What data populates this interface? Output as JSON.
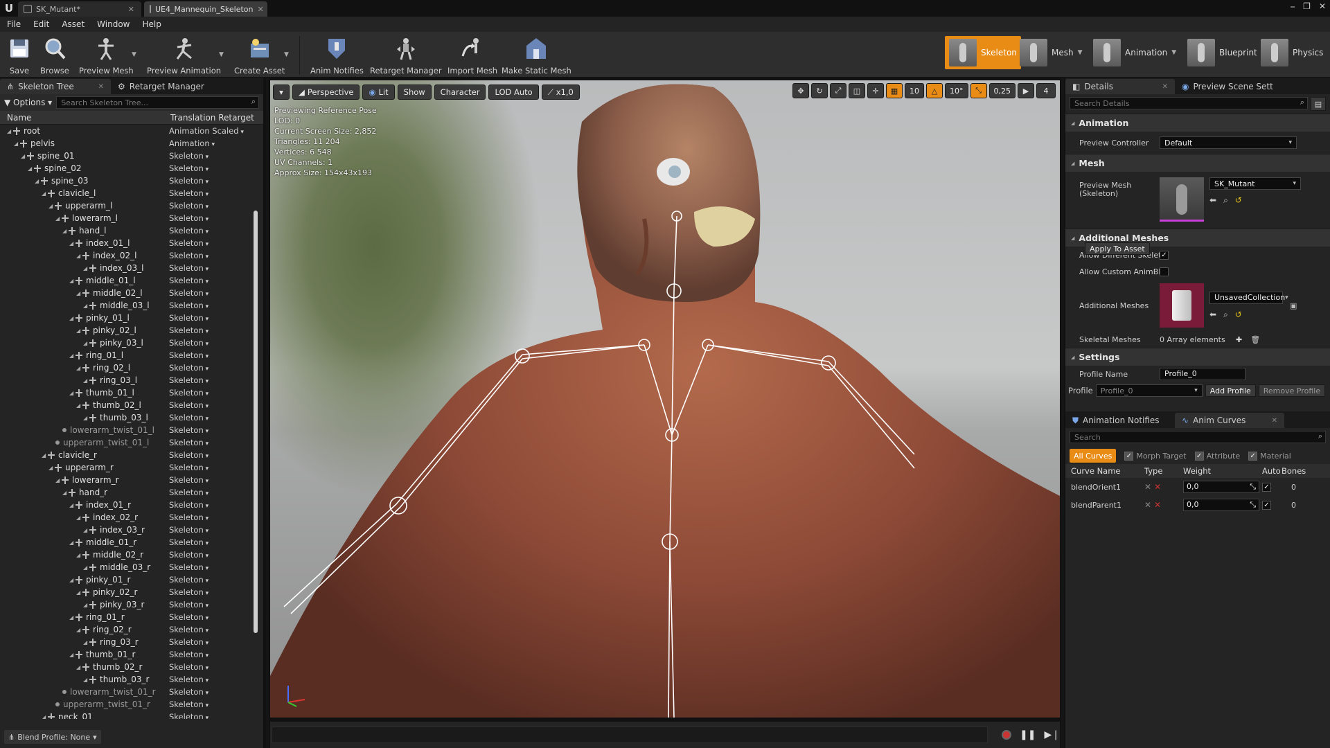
{
  "window": {
    "logo": "U",
    "tabs": [
      {
        "label": "SK_Mutant*"
      },
      {
        "label": "UE4_Mannequin_Skeleton"
      }
    ],
    "controls": [
      "⎯",
      "❐",
      "✕"
    ]
  },
  "menu": [
    "File",
    "Edit",
    "Asset",
    "Window",
    "Help"
  ],
  "toolbar": {
    "buttons": [
      "Save",
      "Browse",
      "Preview Mesh",
      "Preview Animation",
      "Create Asset",
      "Anim Notifies",
      "Retarget Manager",
      "Import Mesh",
      "Make Static Mesh"
    ],
    "modes": [
      "Skeleton",
      "Mesh",
      "Animation",
      "Blueprint",
      "Physics"
    ],
    "active_mode": "Skeleton"
  },
  "left": {
    "tabs": [
      "Skeleton Tree",
      "Retarget Manager"
    ],
    "options_label": "Options",
    "search_placeholder": "Search Skeleton Tree...",
    "col_name": "Name",
    "col_retarget": "Translation Retarget",
    "rows": [
      {
        "n": "root",
        "r": "Animation Scaled",
        "d": 0,
        "b": 1
      },
      {
        "n": "pelvis",
        "r": "Animation",
        "d": 1,
        "b": 1
      },
      {
        "n": "spine_01",
        "r": "Skeleton",
        "d": 2,
        "b": 1
      },
      {
        "n": "spine_02",
        "r": "Skeleton",
        "d": 3,
        "b": 1
      },
      {
        "n": "spine_03",
        "r": "Skeleton",
        "d": 4,
        "b": 1
      },
      {
        "n": "clavicle_l",
        "r": "Skeleton",
        "d": 5,
        "b": 1
      },
      {
        "n": "upperarm_l",
        "r": "Skeleton",
        "d": 6,
        "b": 1
      },
      {
        "n": "lowerarm_l",
        "r": "Skeleton",
        "d": 7,
        "b": 1
      },
      {
        "n": "hand_l",
        "r": "Skeleton",
        "d": 8,
        "b": 1
      },
      {
        "n": "index_01_l",
        "r": "Skeleton",
        "d": 9,
        "b": 1
      },
      {
        "n": "index_02_l",
        "r": "Skeleton",
        "d": 10,
        "b": 1
      },
      {
        "n": "index_03_l",
        "r": "Skeleton",
        "d": 11,
        "b": 1
      },
      {
        "n": "middle_01_l",
        "r": "Skeleton",
        "d": 9,
        "b": 1
      },
      {
        "n": "middle_02_l",
        "r": "Skeleton",
        "d": 10,
        "b": 1
      },
      {
        "n": "middle_03_l",
        "r": "Skeleton",
        "d": 11,
        "b": 1
      },
      {
        "n": "pinky_01_l",
        "r": "Skeleton",
        "d": 9,
        "b": 1
      },
      {
        "n": "pinky_02_l",
        "r": "Skeleton",
        "d": 10,
        "b": 1
      },
      {
        "n": "pinky_03_l",
        "r": "Skeleton",
        "d": 11,
        "b": 1
      },
      {
        "n": "ring_01_l",
        "r": "Skeleton",
        "d": 9,
        "b": 1
      },
      {
        "n": "ring_02_l",
        "r": "Skeleton",
        "d": 10,
        "b": 1
      },
      {
        "n": "ring_03_l",
        "r": "Skeleton",
        "d": 11,
        "b": 1
      },
      {
        "n": "thumb_01_l",
        "r": "Skeleton",
        "d": 9,
        "b": 1
      },
      {
        "n": "thumb_02_l",
        "r": "Skeleton",
        "d": 10,
        "b": 1
      },
      {
        "n": "thumb_03_l",
        "r": "Skeleton",
        "d": 11,
        "b": 1
      },
      {
        "n": "lowerarm_twist_01_l",
        "r": "Skeleton",
        "d": 8,
        "b": 0
      },
      {
        "n": "upperarm_twist_01_l",
        "r": "Skeleton",
        "d": 7,
        "b": 0
      },
      {
        "n": "clavicle_r",
        "r": "Skeleton",
        "d": 5,
        "b": 1
      },
      {
        "n": "upperarm_r",
        "r": "Skeleton",
        "d": 6,
        "b": 1
      },
      {
        "n": "lowerarm_r",
        "r": "Skeleton",
        "d": 7,
        "b": 1
      },
      {
        "n": "hand_r",
        "r": "Skeleton",
        "d": 8,
        "b": 1
      },
      {
        "n": "index_01_r",
        "r": "Skeleton",
        "d": 9,
        "b": 1
      },
      {
        "n": "index_02_r",
        "r": "Skeleton",
        "d": 10,
        "b": 1
      },
      {
        "n": "index_03_r",
        "r": "Skeleton",
        "d": 11,
        "b": 1
      },
      {
        "n": "middle_01_r",
        "r": "Skeleton",
        "d": 9,
        "b": 1
      },
      {
        "n": "middle_02_r",
        "r": "Skeleton",
        "d": 10,
        "b": 1
      },
      {
        "n": "middle_03_r",
        "r": "Skeleton",
        "d": 11,
        "b": 1
      },
      {
        "n": "pinky_01_r",
        "r": "Skeleton",
        "d": 9,
        "b": 1
      },
      {
        "n": "pinky_02_r",
        "r": "Skeleton",
        "d": 10,
        "b": 1
      },
      {
        "n": "pinky_03_r",
        "r": "Skeleton",
        "d": 11,
        "b": 1
      },
      {
        "n": "ring_01_r",
        "r": "Skeleton",
        "d": 9,
        "b": 1
      },
      {
        "n": "ring_02_r",
        "r": "Skeleton",
        "d": 10,
        "b": 1
      },
      {
        "n": "ring_03_r",
        "r": "Skeleton",
        "d": 11,
        "b": 1
      },
      {
        "n": "thumb_01_r",
        "r": "Skeleton",
        "d": 9,
        "b": 1
      },
      {
        "n": "thumb_02_r",
        "r": "Skeleton",
        "d": 10,
        "b": 1
      },
      {
        "n": "thumb_03_r",
        "r": "Skeleton",
        "d": 11,
        "b": 1
      },
      {
        "n": "lowerarm_twist_01_r",
        "r": "Skeleton",
        "d": 8,
        "b": 0
      },
      {
        "n": "upperarm_twist_01_r",
        "r": "Skeleton",
        "d": 7,
        "b": 0
      },
      {
        "n": "neck_01",
        "r": "Skeleton",
        "d": 5,
        "b": 1
      }
    ],
    "blend_profile": "Blend Profile: None"
  },
  "viewport": {
    "buttons": [
      "Perspective",
      "Lit",
      "Show",
      "Character",
      "LOD Auto",
      "x1,0"
    ],
    "right_values": [
      "10",
      "10°",
      "0,25",
      "4"
    ],
    "stats": [
      "Previewing Reference Pose",
      "LOD: 0",
      "Current Screen Size: 2,852",
      "Triangles: 11 204",
      "Vertices: 6 548",
      "UV Channels: 1",
      "Approx Size: 154x43x193"
    ]
  },
  "details": {
    "tabs": [
      "Details",
      "Preview Scene Sett"
    ],
    "search_placeholder": "Search Details",
    "animation_cat": "Animation",
    "preview_controller_label": "Preview Controller",
    "preview_controller_value": "Default",
    "mesh_cat": "Mesh",
    "preview_mesh_label": "Preview Mesh (Skeleton)",
    "preview_mesh_value": "SK_Mutant",
    "apply_btn": "Apply To Asset",
    "additional_cat": "Additional Meshes",
    "allow_diff_label": "Allow Different Skelet",
    "allow_custom_label": "Allow Custom AnimBl",
    "additional_meshes_label": "Additional Meshes",
    "additional_meshes_value": "UnsavedCollection",
    "skeletal_meshes_label": "Skeletal Meshes",
    "skeletal_meshes_value": "0 Array elements",
    "settings_cat": "Settings",
    "profile_name_label": "Profile Name",
    "profile_name_value": "Profile_0",
    "profile_label": "Profile",
    "profile_value": "Profile_0",
    "add_profile": "Add Profile",
    "remove_profile": "Remove Profile"
  },
  "curves": {
    "tabs": [
      "Animation Notifies",
      "Anim Curves"
    ],
    "search_placeholder": "Search",
    "all_curves": "All Curves",
    "filters": [
      "Morph Target",
      "Attribute",
      "Material"
    ],
    "headers": [
      "Curve Name",
      "Type",
      "Weight",
      "Auto",
      "Bones"
    ],
    "rows": [
      {
        "name": "blendOrient1",
        "weight": "0,0",
        "bones": "0"
      },
      {
        "name": "blendParent1",
        "weight": "0,0",
        "bones": "0"
      }
    ]
  },
  "colors": {
    "accent": "#e88c16",
    "bg": "#242424",
    "record": "#cc3333"
  }
}
